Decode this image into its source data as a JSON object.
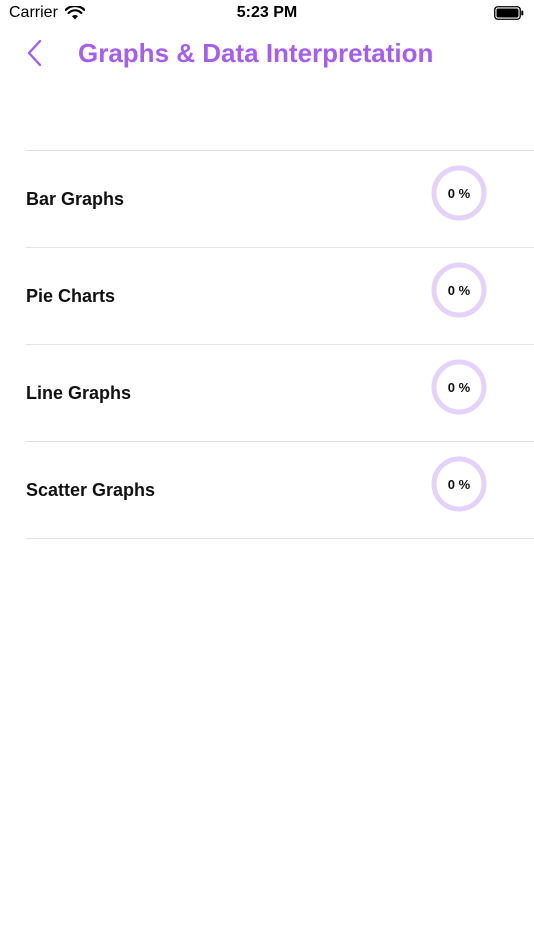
{
  "status_bar": {
    "carrier": "Carrier",
    "time": "5:23 PM"
  },
  "nav": {
    "title": "Graphs & Data Interpretation",
    "back_icon": "chevron-left-icon"
  },
  "topics": [
    {
      "label": "Bar Graphs",
      "progress_text": "0 %",
      "progress": 0
    },
    {
      "label": "Pie Charts",
      "progress_text": "0 %",
      "progress": 0
    },
    {
      "label": "Line Graphs",
      "progress_text": "0 %",
      "progress": 0
    },
    {
      "label": "Scatter Graphs",
      "progress_text": "0 %",
      "progress": 0
    }
  ],
  "colors": {
    "accent": "#a55ef0",
    "ring_track": "#e4d2fb",
    "divider": "#e3e3e3"
  }
}
